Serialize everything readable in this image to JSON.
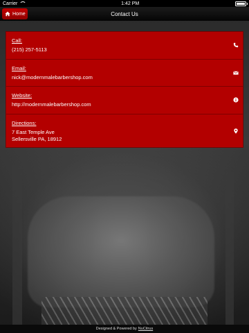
{
  "status_bar": {
    "carrier": "Carrier",
    "time": "1:42 PM",
    "battery_level": 1.0
  },
  "nav": {
    "title": "Contact Us",
    "home_label": "Home"
  },
  "contacts": [
    {
      "label": "Call:",
      "lines": [
        "(215) 257-5113"
      ],
      "icon": "phone-icon"
    },
    {
      "label": "Email:",
      "lines": [
        "nick@modernmalebarbershop.com"
      ],
      "icon": "envelope-icon"
    },
    {
      "label": "Website:",
      "lines": [
        "http://modernmalebarbershop.com"
      ],
      "icon": "info-icon"
    },
    {
      "label": "Directions:",
      "lines": [
        "7 East Temple Ave",
        "Sellersville PA, 18912"
      ],
      "icon": "map-pin-icon"
    }
  ],
  "footer": {
    "text": "Designed & Powered by",
    "link": "NuCitrus"
  },
  "colors": {
    "accent": "#b30000",
    "nav_bg": "#0a0a0a",
    "home_button": "#c40000"
  }
}
